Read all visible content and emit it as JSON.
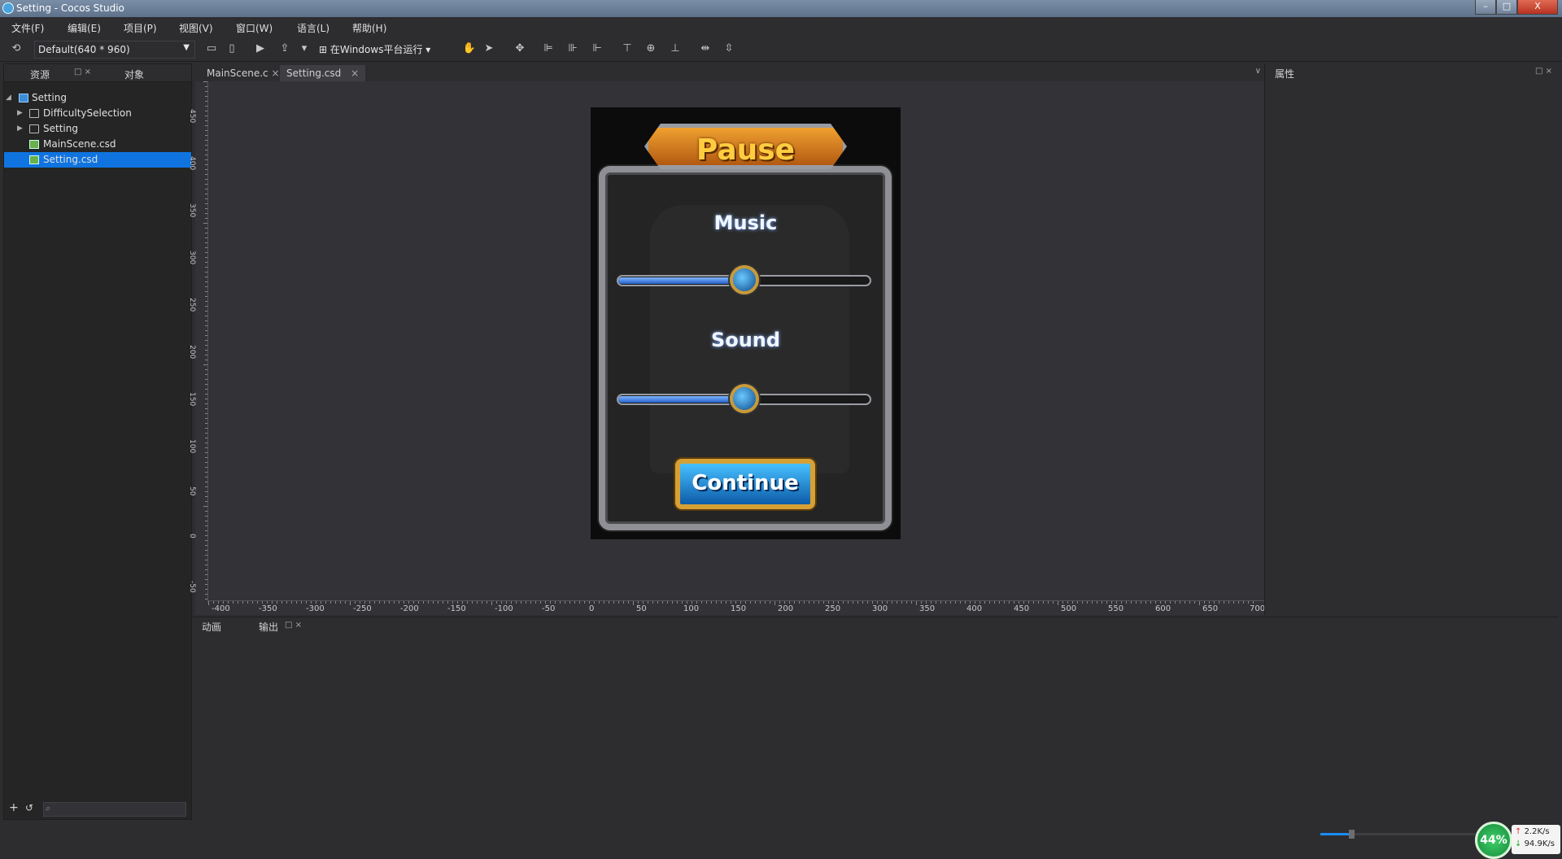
{
  "window": {
    "title": "Setting - Cocos Studio",
    "min": "–",
    "max": "□",
    "close": "X"
  },
  "menu": [
    "文件(F)",
    "编辑(E)",
    "项目(P)",
    "视图(V)",
    "窗口(W)",
    "语言(L)",
    "帮助(H)"
  ],
  "toolbar": {
    "resolution": "Default(640 * 960)",
    "run_label": "在Windows平台运行"
  },
  "left_panel": {
    "tab_resources": "资源",
    "tab_objects": "对象",
    "tree": [
      {
        "label": "Setting",
        "type": "project"
      },
      {
        "label": "DifficultySelection",
        "type": "folder"
      },
      {
        "label": "Setting",
        "type": "folder"
      },
      {
        "label": "MainScene.csd",
        "type": "csd"
      },
      {
        "label": "Setting.csd",
        "type": "csd",
        "selected": true
      }
    ]
  },
  "editor_tabs": [
    "MainScene.c",
    "Setting.csd"
  ],
  "vertical_ruler": [
    "450",
    "400",
    "350",
    "300",
    "250",
    "200",
    "150",
    "100",
    "50",
    "0",
    "-50"
  ],
  "horizontal_ruler": [
    "-400",
    "-350",
    "-300",
    "-250",
    "-200",
    "-150",
    "-100",
    "-50",
    "0",
    "50",
    "100",
    "150",
    "200",
    "250",
    "300",
    "350",
    "400",
    "450",
    "500",
    "550",
    "600",
    "650",
    "700"
  ],
  "scene": {
    "title": "Pause",
    "music_label": "Music",
    "music_level": 0.5,
    "sound_label": "Sound",
    "sound_level": 0.5,
    "continue_label": "Continue"
  },
  "right_panel": {
    "title": "属性"
  },
  "bottom_panel": {
    "tab_animation": "动画",
    "tab_output": "输出"
  },
  "status": {
    "cpu_percent": "44%",
    "upload": "2.2K/s",
    "download": "94.9K/s",
    "zoom_level": 0.2
  }
}
